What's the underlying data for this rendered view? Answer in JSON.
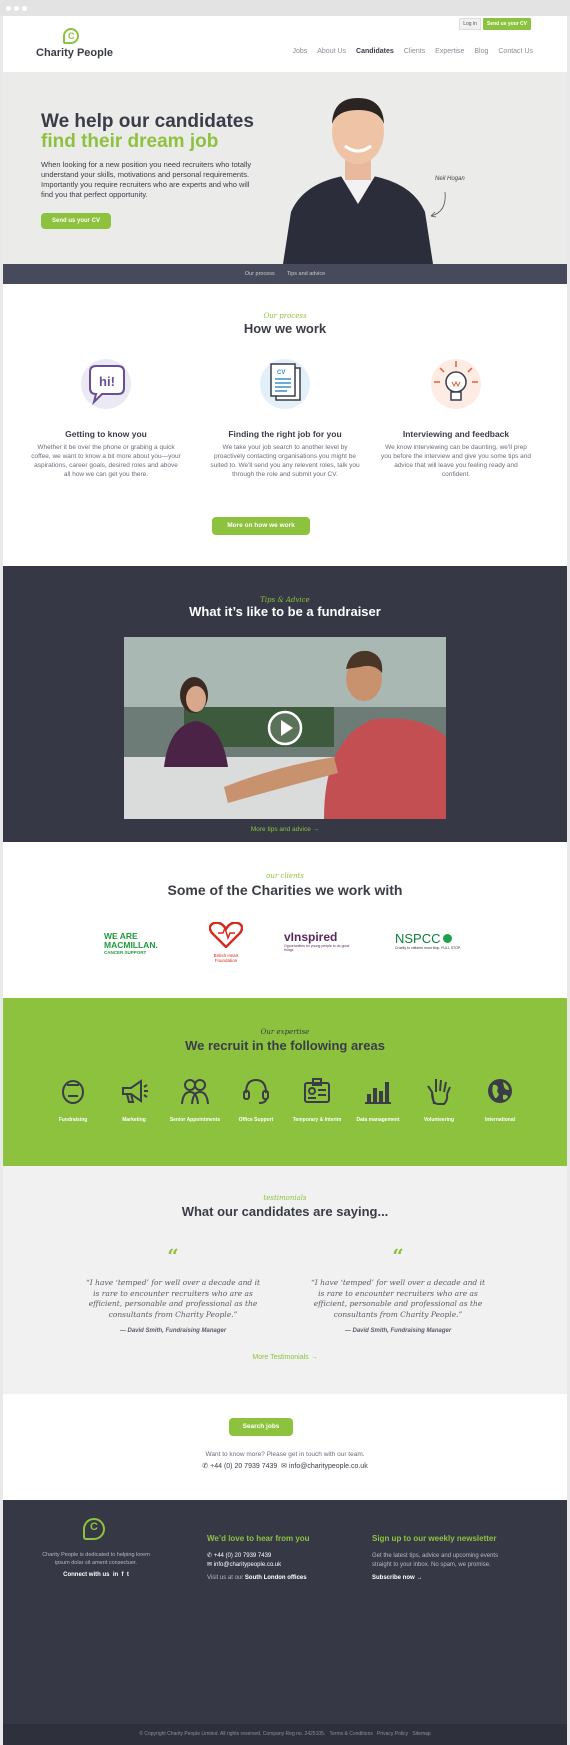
{
  "header": {
    "logo_text": "Charity People",
    "logo_letter": "C",
    "login_label": "Log in",
    "send_cv_label": "Send us your CV",
    "nav": [
      "Jobs",
      "About Us",
      "Candidates",
      "Clients",
      "Expertise",
      "Blog",
      "Contact Us"
    ],
    "active_nav": "Candidates"
  },
  "hero": {
    "title_line1": "We help our candidates",
    "title_line2": "find their dream job",
    "body": "When looking for a new position you need recruiters who totally understand your skills, motivations and personal requirements. Importantly you require recruiters who are experts and who will find you that perfect opportunity.",
    "cta_label": "Send us your CV",
    "person_note": "Neil Hogan"
  },
  "subnav": [
    "Our process",
    "Tips and advice"
  ],
  "how": {
    "small": "Our process",
    "title": "How we work",
    "steps": [
      {
        "icon": "speech-bubble-hi-icon",
        "icon_text": "hi!",
        "title": "Getting to know you",
        "text": "Whether it be over the phone or grabing a quick coffee, we want to know a bit more about you—your aspirations, career goals, desired roles and above all how we can get you there."
      },
      {
        "icon": "cv-document-icon",
        "icon_text": "CV",
        "title": "Finding the right job for you",
        "text": "We take your job search to another level by proactively contacting organisations you might be suited to. We'll send you any relevent roles, talk you through the role and submit your CV."
      },
      {
        "icon": "light-bulb-icon",
        "title": "Interviewing and feedback",
        "text": "We know interviewing can be daunting, we'll prep you before the interview and give you some tips and advice that will leave you feeling ready and confident."
      }
    ],
    "more_label": "More on how we work"
  },
  "video": {
    "small": "Tips & Advice",
    "title": "What it’s like to be a fundraiser",
    "more_label": "More tips and advice →"
  },
  "clients": {
    "small": "our clients",
    "title": "Some of the Charities we work with",
    "logos": {
      "macmillan": "WE ARE MACMILLAN.",
      "macmillan_sub": "CANCER SUPPORT",
      "bhf": "British Heart Foundation",
      "vinspired": "vInspired",
      "vinspired_sub": "Opportunities for young people to do good things",
      "nspcc": "NSPCC",
      "nspcc_sub": "Cruelty to children must stop. FULL STOP."
    }
  },
  "expertise": {
    "small": "Our expertise",
    "title": "We recruit in the following areas",
    "areas": [
      {
        "label": "Fundraising",
        "icon": "piggy-bank-icon"
      },
      {
        "label": "Marketing",
        "icon": "megaphone-icon"
      },
      {
        "label": "Senior Appointments",
        "icon": "people-icon"
      },
      {
        "label": "Office Support",
        "icon": "headset-icon"
      },
      {
        "label": "Temporary & Interim",
        "icon": "id-badge-icon"
      },
      {
        "label": "Data management",
        "icon": "bar-chart-icon"
      },
      {
        "label": "Volunteering",
        "icon": "raised-hand-icon"
      },
      {
        "label": "International",
        "icon": "globe-icon"
      }
    ]
  },
  "testimonials": {
    "small": "testimonials",
    "title": "What our candidates are saying...",
    "quotes": [
      {
        "text": "“I have ‘temped’ for well over a decade and it is rare to encounter recruiters who are as efficient, personable and professional as the consultants from Charity People.”",
        "author": "— David Smith, Fundraising Manager"
      },
      {
        "text": "“I have ‘temped’ for well over a decade and it is rare to encounter recruiters who are as efficient, personable and professional as the consultants from Charity People.”",
        "author": "— David Smith, Fundraising Manager"
      }
    ],
    "more_label": "More Testimonials →"
  },
  "search": {
    "button_label": "Search jobs",
    "prompt": "Want to know more? Please get in touch with our team.",
    "phone": "+44 (0) 20 7939 7439",
    "email": "info@charitypeople.co.uk"
  },
  "footer": {
    "about": "Charity People is dedicated to helping lorem ipsum dolar sit ament consectuer.",
    "connect": "Connect with us",
    "hear_title": "We’d love to hear from you",
    "phone": "+44 (0) 20 7939 7439",
    "email": "info@charitypeople.co.uk",
    "visit_prefix": "Visit us at our",
    "visit_link": "South London offices",
    "news_title": "Sign up to our weekly newsletter",
    "news_text": "Get the latest tips, advice and upcoming events straight to your inbox. No spam, we promise.",
    "subscribe": "Subscribe now →",
    "copyright": "© Copyright Charity People Limited. All rights reserved. Company Reg no. 2425105.",
    "terms": "Terms & Conditions",
    "privacy": "Privacy Policy",
    "sitemap": "Sitemap"
  },
  "colors": {
    "accent": "#8dc23f",
    "dark": "#363845",
    "text": "#3a3d48"
  }
}
